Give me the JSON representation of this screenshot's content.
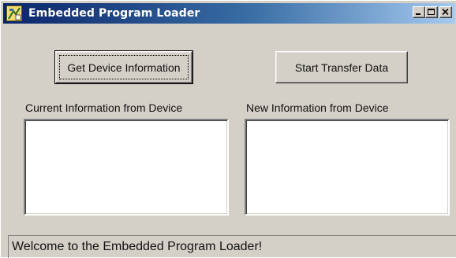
{
  "window": {
    "title": "Embedded Program Loader",
    "icon": "loader-app-icon",
    "controls": [
      "minimize-icon",
      "maximize-icon",
      "close-icon"
    ]
  },
  "buttons": {
    "get_device_info": "Get Device Information",
    "start_transfer": "Start Transfer Data"
  },
  "panels": {
    "current_label": "Current Information from Device",
    "current_value": "",
    "new_label": "New Information from Device",
    "new_value": ""
  },
  "status": {
    "message": "Welcome to the Embedded Program Loader!"
  },
  "colors": {
    "face": "#d4d0c8",
    "titlebar_start": "#0a246a",
    "titlebar_end": "#a6caf0"
  }
}
